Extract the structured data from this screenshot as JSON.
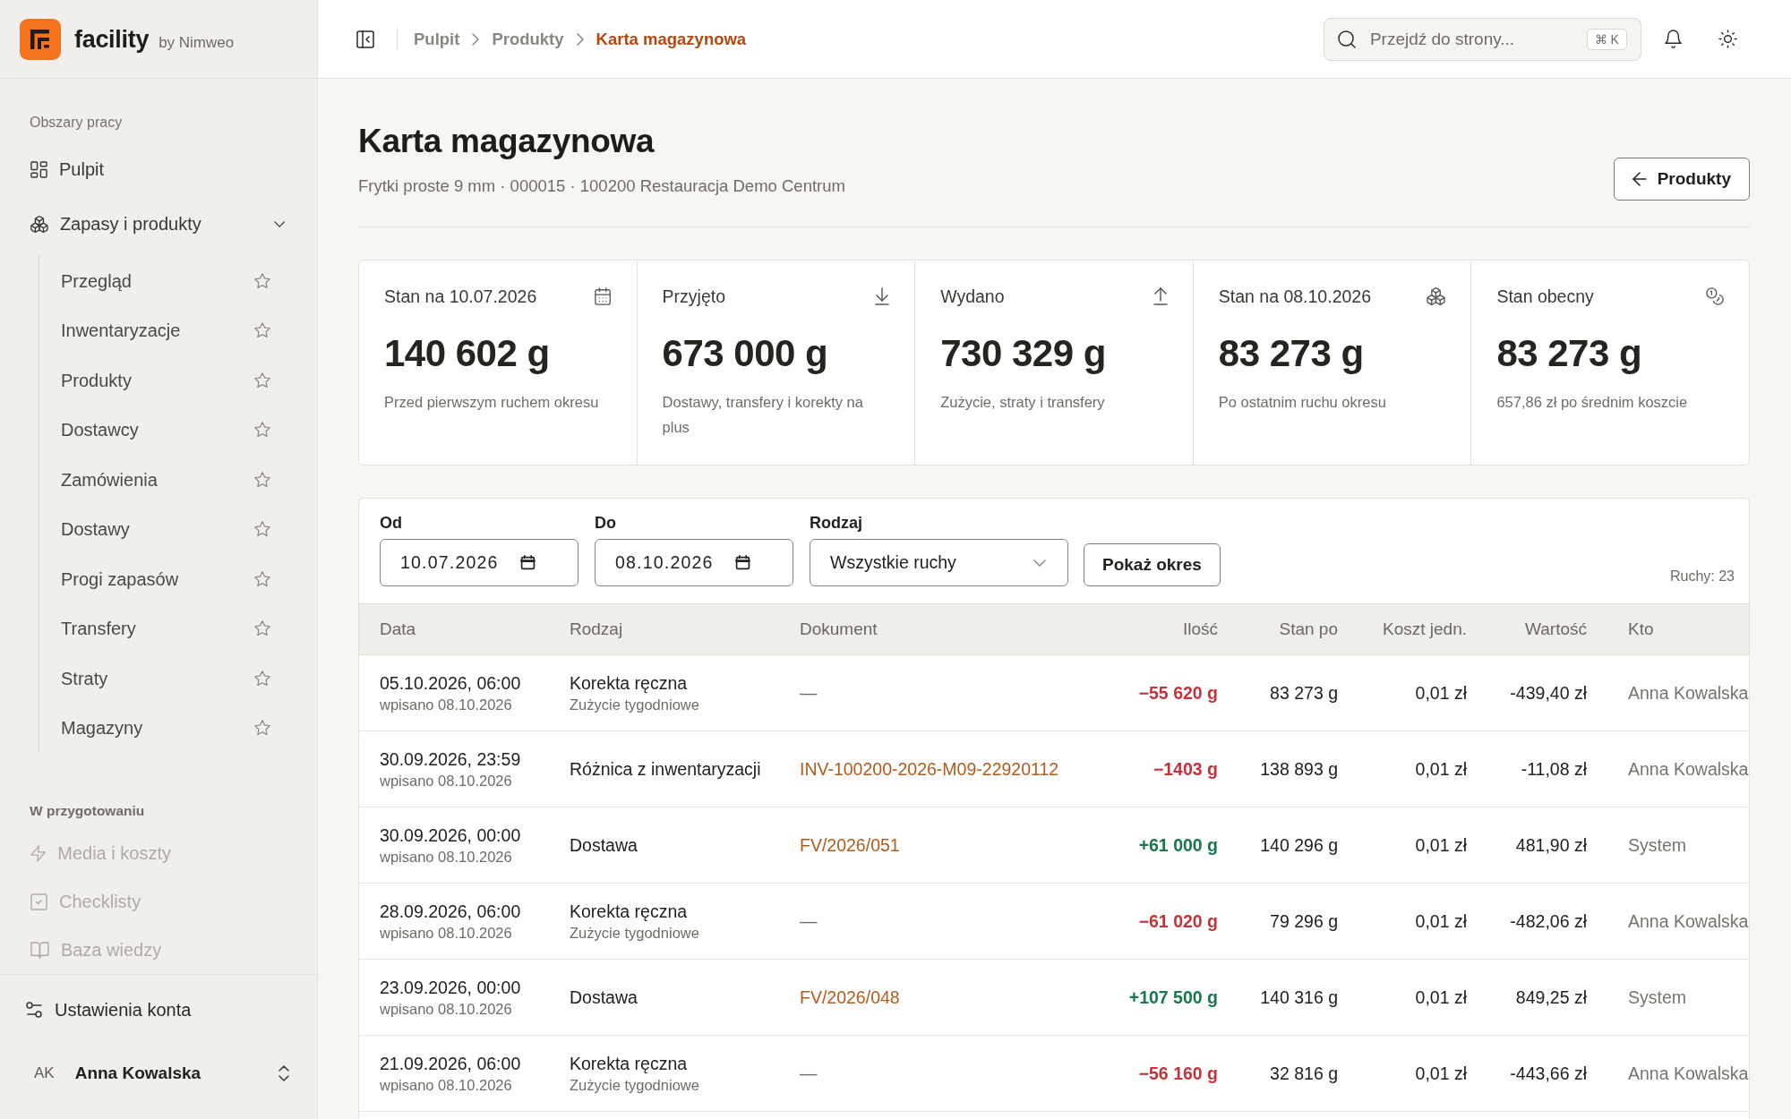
{
  "sidebar": {
    "brand": {
      "name": "facility",
      "byline": "by Nimweo"
    },
    "groups": [
      {
        "title": "Obszary pracy",
        "kind": "workspace",
        "items": [
          {
            "label": "Pulpit",
            "kind": "link",
            "disabled": false
          },
          {
            "label": "Zapasy i produkty",
            "kind": "group",
            "disabled": false,
            "expanded": true,
            "children": [
              {
                "label": "Przegląd",
                "starred": false
              },
              {
                "label": "Inwentaryzacje",
                "starred": false
              },
              {
                "label": "Produkty",
                "starred": false
              },
              {
                "label": "Dostawcy",
                "starred": false
              },
              {
                "label": "Zamówienia",
                "starred": false
              },
              {
                "label": "Dostawy",
                "starred": false
              },
              {
                "label": "Progi zapasów",
                "starred": false
              },
              {
                "label": "Transfery",
                "starred": false
              },
              {
                "label": "Straty",
                "starred": false
              },
              {
                "label": "Magazyny",
                "starred": false
              }
            ]
          }
        ]
      },
      {
        "title": "W przygotowaniu",
        "kind": "upcoming",
        "items": [
          {
            "label": "Media i koszty",
            "kind": "link",
            "disabled": true
          },
          {
            "label": "Checklisty",
            "kind": "link",
            "disabled": true
          },
          {
            "label": "Baza wiedzy",
            "kind": "link",
            "disabled": true
          }
        ]
      }
    ],
    "settings_link": "Ustawienia konta",
    "user": {
      "initials": "AK",
      "name": "Anna Kowalska"
    }
  },
  "topbar": {
    "breadcrumbs": [
      {
        "label": "Pulpit",
        "current": false
      },
      {
        "label": "Produkty",
        "current": false
      },
      {
        "label": "Karta magazynowa",
        "current": true
      }
    ],
    "search": {
      "placeholder": "Przejdź do strony...",
      "shortcut": "⌘ K"
    }
  },
  "header": {
    "title": "Karta magazynowa",
    "subtitle": "Frytki proste 9 mm · 000015 · 100200 Restauracja Demo Centrum",
    "back_button": "Produkty"
  },
  "stats": [
    {
      "label": "Stan na 10.07.2026",
      "value": "140 602 g",
      "note": "Przed pierwszym ruchem okresu"
    },
    {
      "label": "Przyjęto",
      "value": "673 000 g",
      "note": "Dostawy, transfery i korekty na plus"
    },
    {
      "label": "Wydano",
      "value": "730 329 g",
      "note": "Zużycie, straty i transfery"
    },
    {
      "label": "Stan na 08.10.2026",
      "value": "83 273 g",
      "note": "Po ostatnim ruchu okresu"
    },
    {
      "label": "Stan obecny",
      "value": "83 273 g",
      "note": "657,86 zł po średnim koszcie"
    }
  ],
  "filters": {
    "fields": [
      {
        "label": "Od",
        "kind": "date",
        "value": "10.07.2026"
      },
      {
        "label": "Do",
        "kind": "date",
        "value": "08.10.2026"
      },
      {
        "label": "Rodzaj",
        "kind": "select",
        "value": "Wszystkie ruchy"
      }
    ],
    "submit": "Pokaż okres",
    "count": "Ruchy: 23"
  },
  "table": {
    "columns": [
      {
        "label": "Data",
        "kind": "text"
      },
      {
        "label": "Rodzaj",
        "kind": "text"
      },
      {
        "label": "Dokument",
        "kind": "text"
      },
      {
        "label": "Ilość",
        "kind": "number"
      },
      {
        "label": "Stan po",
        "kind": "number"
      },
      {
        "label": "Koszt jedn.",
        "kind": "number"
      },
      {
        "label": "Wartość",
        "kind": "number"
      },
      {
        "label": "Kto",
        "kind": "text"
      }
    ],
    "rows": [
      {
        "date": "05.10.2026, 06:00",
        "entered": "wpisano 08.10.2026",
        "type": "Korekta ręczna",
        "type_note": "Zużycie tygodniowe",
        "document": {
          "text": "—",
          "linked": false
        },
        "quantity": {
          "text": "−55 620 g",
          "kind": "negative"
        },
        "balance": "83 273 g",
        "unit_cost": "0,01 zł",
        "amount": "-439,40 zł",
        "author": "Anna Kowalska"
      },
      {
        "date": "30.09.2026, 23:59",
        "entered": "wpisano 08.10.2026",
        "type": "Różnica z inwentaryzacji",
        "document": {
          "text": "INV-100200-2026-M09-22920112",
          "linked": true
        },
        "quantity": {
          "text": "−1403 g",
          "kind": "negative"
        },
        "balance": "138 893 g",
        "unit_cost": "0,01 zł",
        "amount": "-11,08 zł",
        "author": "Anna Kowalska"
      },
      {
        "date": "30.09.2026, 00:00",
        "entered": "wpisano 08.10.2026",
        "type": "Dostawa",
        "document": {
          "text": "FV/2026/051",
          "linked": true
        },
        "quantity": {
          "text": "+61 000 g",
          "kind": "positive"
        },
        "balance": "140 296 g",
        "unit_cost": "0,01 zł",
        "amount": "481,90 zł",
        "author": "System"
      },
      {
        "date": "28.09.2026, 06:00",
        "entered": "wpisano 08.10.2026",
        "type": "Korekta ręczna",
        "type_note": "Zużycie tygodniowe",
        "document": {
          "text": "—",
          "linked": false
        },
        "quantity": {
          "text": "−61 020 g",
          "kind": "negative"
        },
        "balance": "79 296 g",
        "unit_cost": "0,01 zł",
        "amount": "-482,06 zł",
        "author": "Anna Kowalska"
      },
      {
        "date": "23.09.2026, 00:00",
        "entered": "wpisano 08.10.2026",
        "type": "Dostawa",
        "document": {
          "text": "FV/2026/048",
          "linked": true
        },
        "quantity": {
          "text": "+107 500 g",
          "kind": "positive"
        },
        "balance": "140 316 g",
        "unit_cost": "0,01 zł",
        "amount": "849,25 zł",
        "author": "System"
      },
      {
        "date": "21.09.2026, 06:00",
        "entered": "wpisano 08.10.2026",
        "type": "Korekta ręczna",
        "type_note": "Zużycie tygodniowe",
        "document": {
          "text": "—",
          "linked": false
        },
        "quantity": {
          "text": "−56 160 g",
          "kind": "negative"
        },
        "balance": "32 816 g",
        "unit_cost": "0,01 zł",
        "amount": "-443,66 zł",
        "author": "Anna Kowalska"
      }
    ]
  }
}
